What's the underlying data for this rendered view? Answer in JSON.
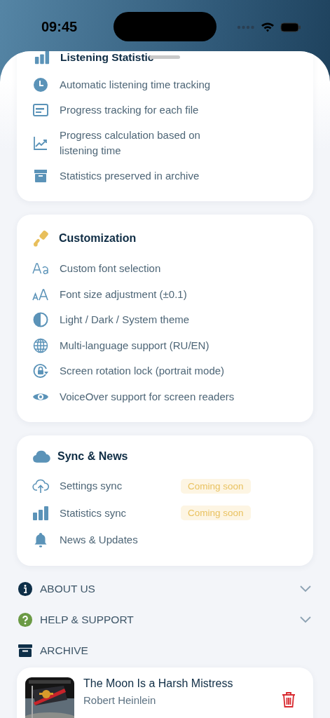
{
  "status_bar": {
    "time": "09:45"
  },
  "cards": [
    {
      "title": "Listening Statistic",
      "rows": [
        {
          "label": "Automatic listening time tracking"
        },
        {
          "label": "Progress tracking for each file"
        },
        {
          "label": "Progress calculation based on listening time"
        },
        {
          "label": "Statistics preserved in archive"
        }
      ]
    },
    {
      "title": "Customization",
      "rows": [
        {
          "label": "Custom font selection"
        },
        {
          "label": "Font size adjustment (±0.1)"
        },
        {
          "label": "Light / Dark / System theme"
        },
        {
          "label": "Multi-language support (RU/EN)"
        },
        {
          "label": "Screen rotation lock (portrait mode)"
        },
        {
          "label": "VoiceOver support for screen readers"
        }
      ]
    },
    {
      "title": "Sync & News",
      "rows": [
        {
          "label": "Settings sync",
          "badge": "Coming soon"
        },
        {
          "label": "Statistics sync",
          "badge": "Coming soon"
        },
        {
          "label": "News & Updates"
        }
      ]
    }
  ],
  "sections": [
    {
      "label": "ABOUT US",
      "expanded": false
    },
    {
      "label": "HELP & SUPPORT",
      "expanded": false
    }
  ],
  "archive": {
    "title": "ARCHIVE",
    "book": {
      "title": "The Moon Is a Harsh Mistress",
      "author": "Robert Heinlein"
    }
  }
}
